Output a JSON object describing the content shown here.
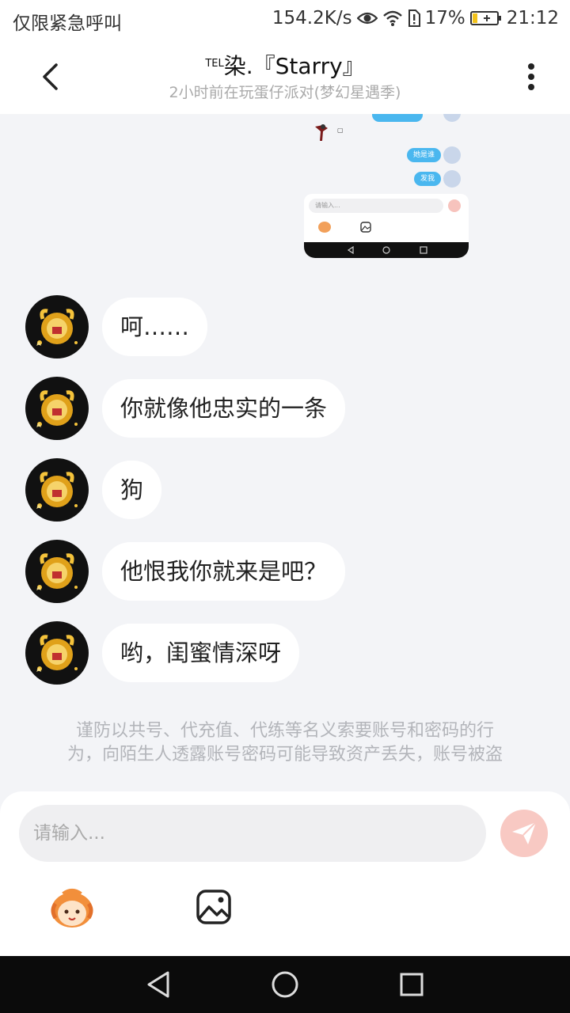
{
  "status_bar": {
    "left_text": "仅限紧急呼叫",
    "speed": "154.2K/s",
    "battery_percent": "17%",
    "time": "21:12"
  },
  "header": {
    "title_prefix": "TEL",
    "title": "染.『Starry』",
    "subtitle": "2小时前在玩蛋仔派对(梦幻星遇季)"
  },
  "shared_screenshot": {
    "bubble_1": "她是谁",
    "bubble_2": "发我",
    "input_placeholder": "请输入..."
  },
  "messages": [
    {
      "text": "呵……"
    },
    {
      "text": "你就像他忠实的一条"
    },
    {
      "text": "狗"
    },
    {
      "text": "他恨我你就来是吧？"
    },
    {
      "text": "哟，闺蜜情深呀"
    }
  ],
  "notice": {
    "line1": "谨防以共号、代充值、代练等名义索要账号和密码的行",
    "line2": "为，向陌生人透露账号密码可能导致资产丢失，账号被盗"
  },
  "composer": {
    "placeholder": "请输入..."
  },
  "colors": {
    "accent_blue": "#4ab7ef",
    "send_button": "#f8c9c3",
    "background": "#f3f4f7"
  },
  "icons": {
    "back": "chevron-left-icon",
    "more": "more-vertical-icon",
    "send": "paper-plane-icon",
    "emoji": "eggy-emoji-icon",
    "image": "image-icon"
  }
}
